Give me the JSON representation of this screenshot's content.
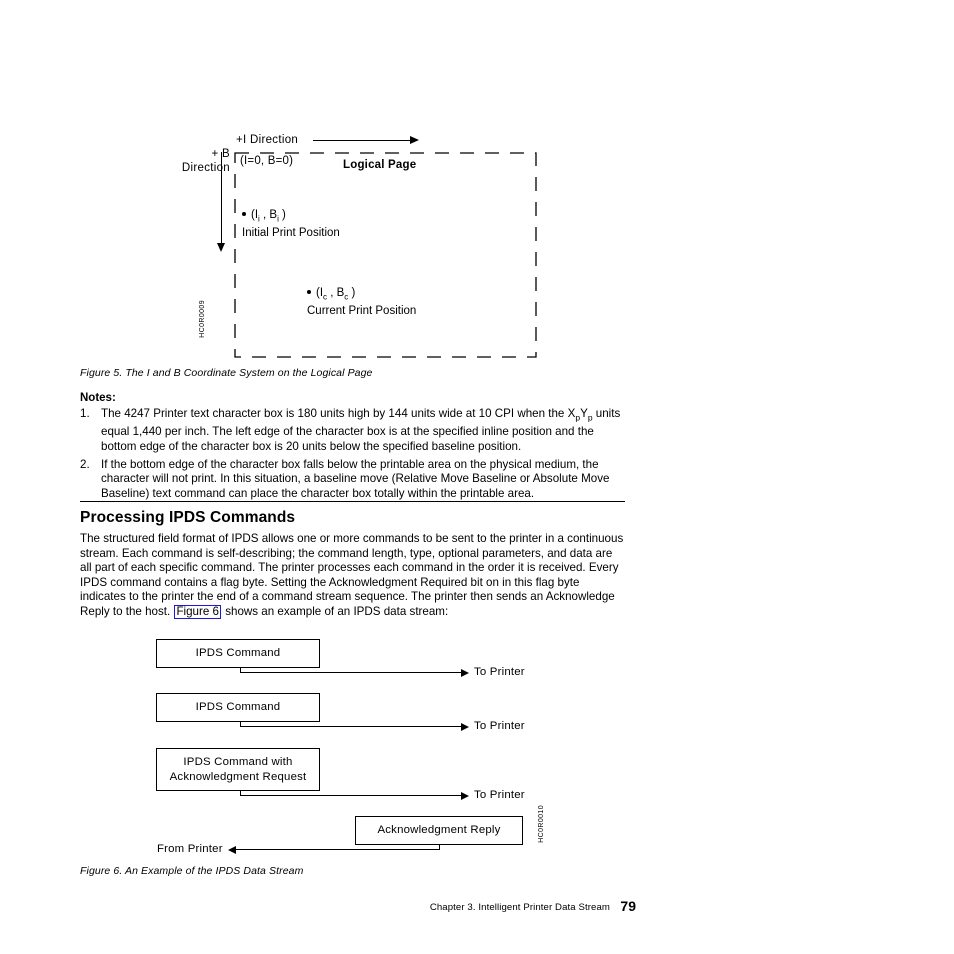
{
  "figure5": {
    "inline_direction_label": "+I Direction",
    "baseline_direction_label": "+ B\nDirection",
    "baseline_direction_line1": "+ B",
    "baseline_direction_line2": "Direction",
    "origin_label": "(I=0,  B=0)",
    "logical_page_label": "Logical Page",
    "initial_point_label": "(I i , B i )",
    "initial_point_caption": "Initial Print Position",
    "current_point_label": "(I c , B c )",
    "current_point_caption": "Current Print Position",
    "graphic_id": "HC0R0009",
    "caption": "Figure 5. The I and B Coordinate System on the Logical Page"
  },
  "notes": {
    "heading": "Notes:",
    "items": [
      {
        "number": "1.",
        "text_part1": "The 4247 Printer text character box is 180 units high by 144 units wide at 10 CPI when the X",
        "sub1": "p",
        "text_part2": "Y",
        "sub2": "p",
        "text_part3": " units equal 1,440 per inch. The left edge of the character box is at the specified inline position and the bottom edge of the character box is 20 units below the specified baseline position."
      },
      {
        "number": "2.",
        "text_part1": "If the bottom edge of the character box falls below the printable area on the physical medium, the character will not print. In this situation, a baseline move (Relative Move Baseline or Absolute Move Baseline) text command can place the character box totally within the printable area.",
        "sub1": "",
        "text_part2": "",
        "sub2": "",
        "text_part3": ""
      }
    ]
  },
  "section": {
    "heading": "Processing IPDS Commands",
    "paragraph_before_link": "The structured field format of IPDS allows one or more commands to be sent to the printer in a continuous stream. Each command is self-describing; the command length, type, optional parameters, and data are all part of each specific command. The printer processes each command in the order it is received. Every IPDS command contains a flag byte. Setting the Acknowledgment Required bit on in this flag byte indicates to the printer the end of a command stream sequence. The printer then sends an Acknowledge Reply to the host. ",
    "figure_link": "Figure 6",
    "paragraph_after_link": " shows an example of an IPDS data stream:",
    "link_border_color": "#1a1ad6"
  },
  "figure6": {
    "box1_label": "IPDS Command",
    "box2_label": "IPDS Command",
    "box3_line1": "IPDS Command with",
    "box3_line2": "Acknowledgment Request",
    "box4_label": "Acknowledgment Reply",
    "to_printer_1": "To Printer",
    "to_printer_2": "To Printer",
    "to_printer_3": "To Printer",
    "from_printer": "From Printer",
    "graphic_id": "HC0R0010",
    "caption": "Figure 6. An Example of the IPDS Data Stream"
  },
  "footer": {
    "chapter_text": "Chapter 3. Intelligent Printer Data Stream",
    "page_number": "79"
  }
}
